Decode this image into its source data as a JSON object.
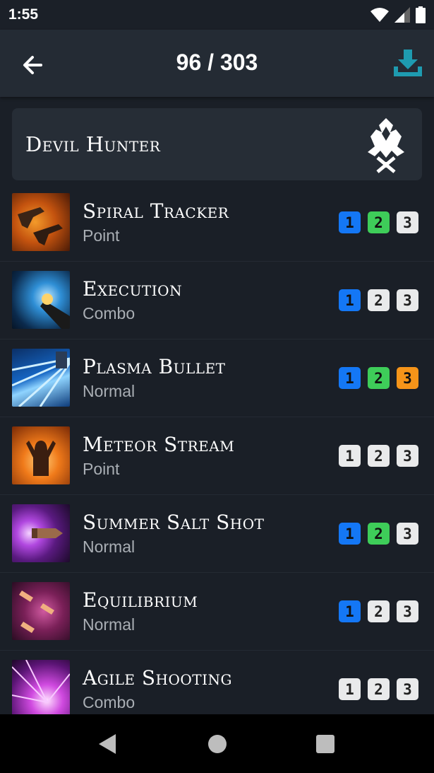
{
  "status": {
    "time": "1:55"
  },
  "header": {
    "counter": "96 / 303"
  },
  "class_card": {
    "name": "Devil Hunter"
  },
  "skills": [
    {
      "name": "Spiral Tracker",
      "type": "Point",
      "icon": "spiral-tracker-icon",
      "tripods": [
        {
          "label": "1",
          "state": "blue"
        },
        {
          "label": "2",
          "state": "green"
        },
        {
          "label": "3",
          "state": "off"
        }
      ]
    },
    {
      "name": "Execution",
      "type": "Combo",
      "icon": "execution-icon",
      "tripods": [
        {
          "label": "1",
          "state": "blue"
        },
        {
          "label": "2",
          "state": "off"
        },
        {
          "label": "3",
          "state": "off"
        }
      ]
    },
    {
      "name": "Plasma Bullet",
      "type": "Normal",
      "icon": "plasma-bullet-icon",
      "tripods": [
        {
          "label": "1",
          "state": "blue"
        },
        {
          "label": "2",
          "state": "green"
        },
        {
          "label": "3",
          "state": "orange"
        }
      ]
    },
    {
      "name": "Meteor Stream",
      "type": "Point",
      "icon": "meteor-stream-icon",
      "tripods": [
        {
          "label": "1",
          "state": "off"
        },
        {
          "label": "2",
          "state": "off"
        },
        {
          "label": "3",
          "state": "off"
        }
      ]
    },
    {
      "name": "Summer Salt Shot",
      "type": "Normal",
      "icon": "summer-salt-shot-icon",
      "tripods": [
        {
          "label": "1",
          "state": "blue"
        },
        {
          "label": "2",
          "state": "green"
        },
        {
          "label": "3",
          "state": "off"
        }
      ]
    },
    {
      "name": "Equilibrium",
      "type": "Normal",
      "icon": "equilibrium-icon",
      "tripods": [
        {
          "label": "1",
          "state": "blue"
        },
        {
          "label": "2",
          "state": "off"
        },
        {
          "label": "3",
          "state": "off"
        }
      ]
    },
    {
      "name": "Agile Shooting",
      "type": "Combo",
      "icon": "agile-shooting-icon",
      "tripods": [
        {
          "label": "1",
          "state": "off"
        },
        {
          "label": "2",
          "state": "off"
        },
        {
          "label": "3",
          "state": "off"
        }
      ]
    }
  ],
  "colors": {
    "accent": "#1e9bb0",
    "tier1": "#1477f5",
    "tier2": "#3ecd59",
    "tier3": "#f69419",
    "inactive": "#e9eaeb"
  }
}
